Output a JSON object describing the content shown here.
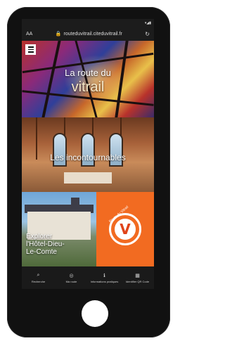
{
  "browser": {
    "text_size_label": "AA",
    "url": "routeduvitrail.citeduvitrail.fr",
    "lock_icon": "lock-icon",
    "reload_icon": "reload-icon"
  },
  "status": {
    "icons": "▾◢▮"
  },
  "menu": {
    "icon": "hamburger-menu-icon"
  },
  "hero": {
    "title_line1": "La route du",
    "title_line2": "vitrail"
  },
  "sections": {
    "incontournables": "Les incontournables",
    "explore_line1": "Explorer",
    "explore_line2": "l'Hôtel-Dieu-",
    "explore_line3": "Le-Comte",
    "logo_letter": "V",
    "logo_text": "Route du Vitrail"
  },
  "bottom_nav": [
    {
      "icon": "⌕",
      "label": "Recherche"
    },
    {
      "icon": "◎",
      "label": "Ma route"
    },
    {
      "icon": "ℹ",
      "label": "Informations pratiques"
    },
    {
      "icon": "▦",
      "label": "Identifier QR Code"
    }
  ],
  "colors": {
    "accent_orange": "#f26b21",
    "nav_bg": "#1a1a1a"
  }
}
